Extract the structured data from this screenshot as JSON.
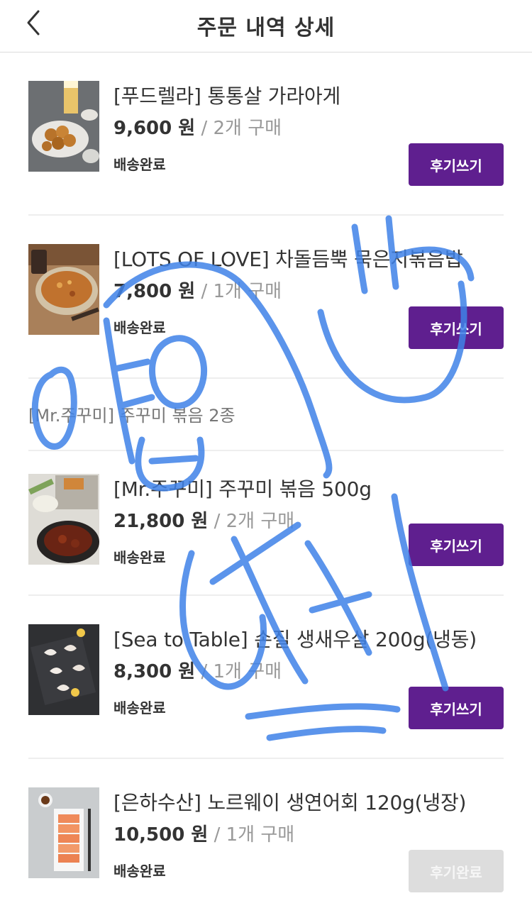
{
  "header": {
    "title": "주문 내역 상세",
    "back_icon": "chevron-left-icon"
  },
  "colors": {
    "brand_purple": "#5f1f8f",
    "disabled_gray": "#dddddd",
    "scribble_blue": "#3f82e8"
  },
  "items": [
    {
      "name": "[푸드렐라] 통통살 가라아게",
      "price": "9,600 원",
      "qty": "/ 2개 구매",
      "status": "배송완료",
      "button": "후기쓰기",
      "button_state": "active"
    },
    {
      "name": "[LOTS OF LOVE] 차돌듬뿍 묵은지볶음밥",
      "price": "7,800 원",
      "qty": "/ 1개 구매",
      "status": "배송완료",
      "button": "후기쓰기",
      "button_state": "active"
    },
    {
      "name": "[Mr.주꾸미] 주꾸미 볶음 500g",
      "price": "21,800 원",
      "qty": "/ 2개 구매",
      "status": "배송완료",
      "button": "후기쓰기",
      "button_state": "active"
    },
    {
      "name": "[Sea to Table] 손질 생새우살 200g(냉동)",
      "price": "8,300 원",
      "qty": "/ 1개 구매",
      "status": "배송완료",
      "button": "후기쓰기",
      "button_state": "active"
    },
    {
      "name": "[은하수산] 노르웨이 생연어회 120g(냉장)",
      "price": "10,500 원",
      "qty": "/ 1개 구매",
      "status": "배송완료",
      "button": "후기완료",
      "button_state": "disabled"
    }
  ],
  "group": {
    "title": "[Mr.주꾸미] 주꾸미 볶음 2종"
  }
}
